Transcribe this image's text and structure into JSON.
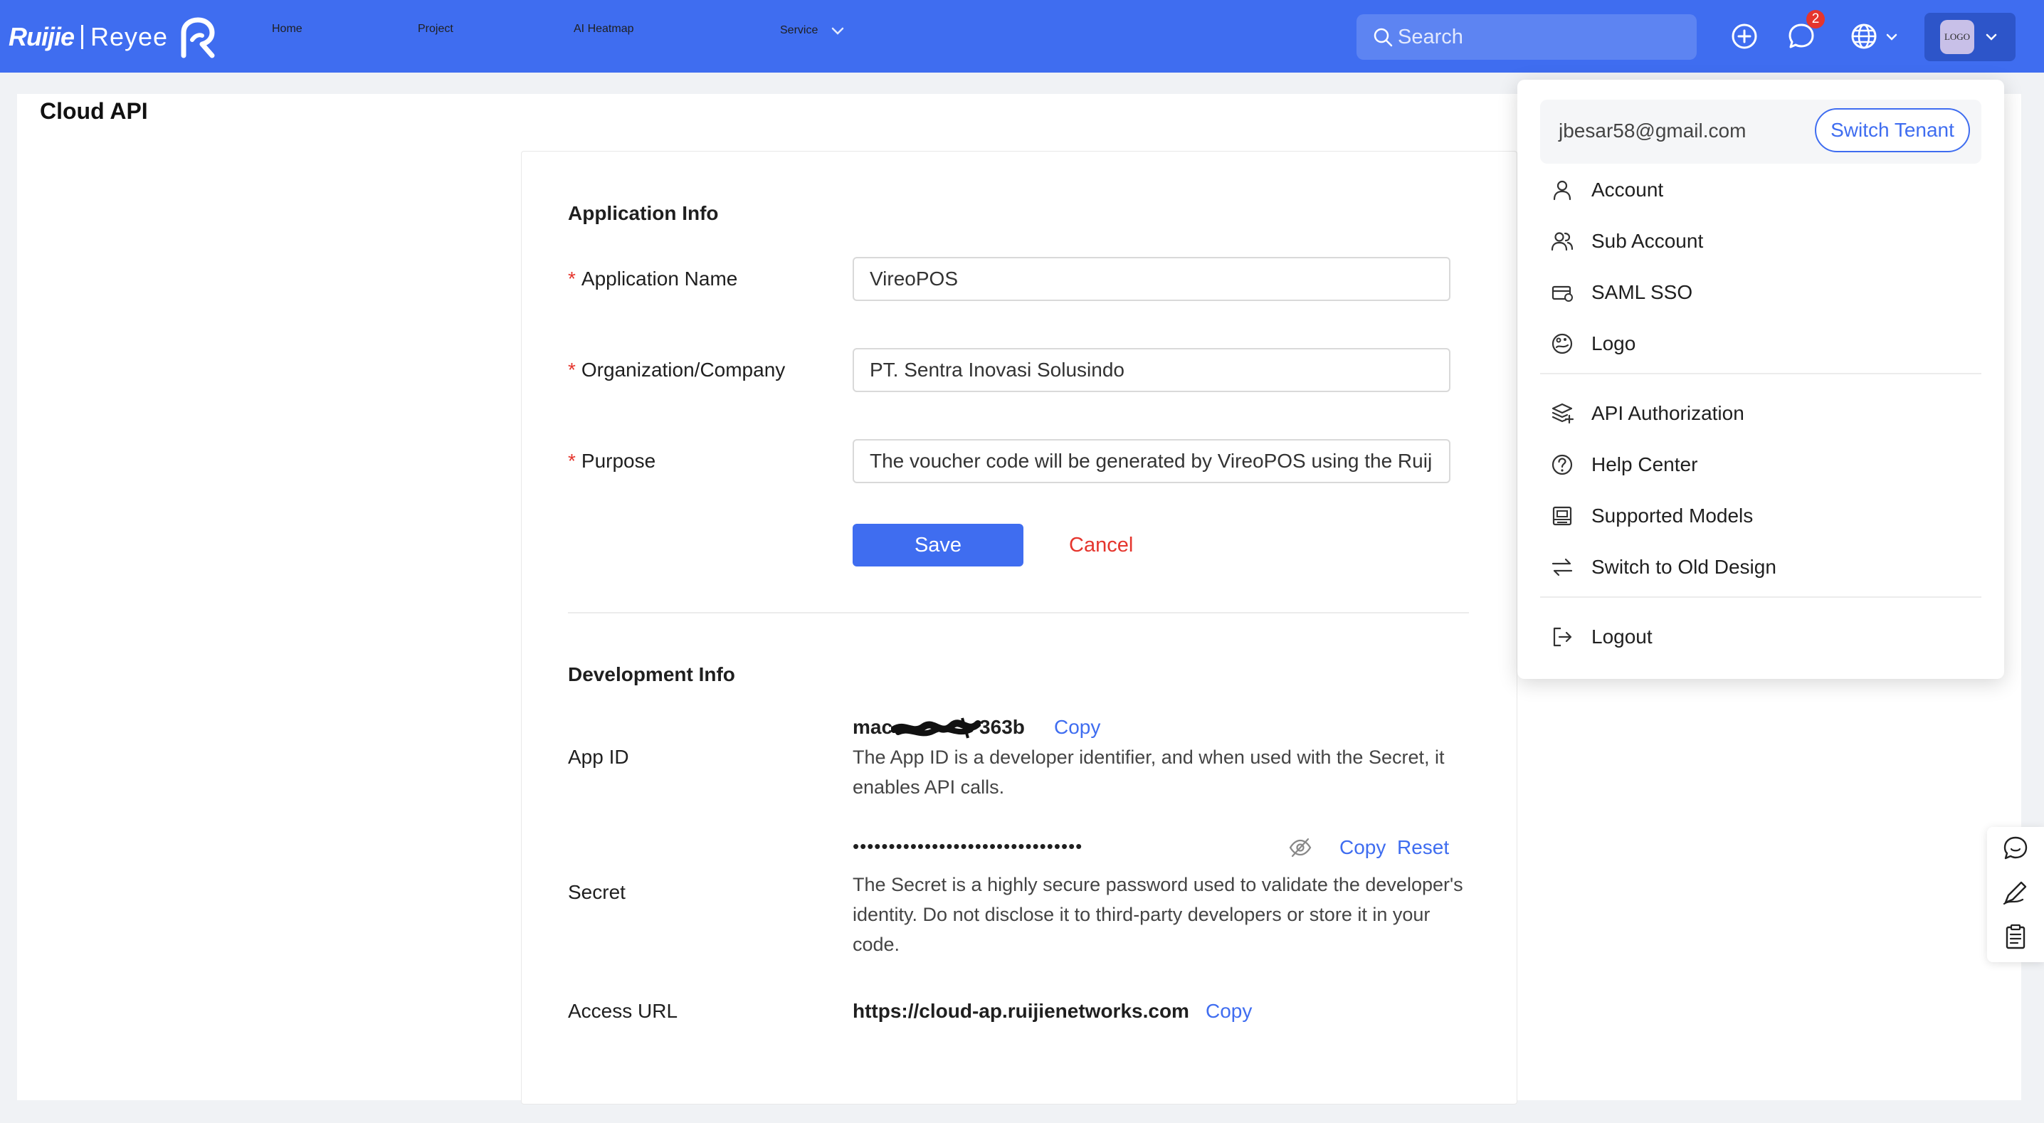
{
  "header": {
    "brand_ruijie": "Ruijie",
    "brand_reyee": "Reyee",
    "nav": [
      "Home",
      "Project",
      "AI Heatmap",
      "Service"
    ],
    "search_placeholder": "Search",
    "notification_count": "2",
    "avatar_text": "LOGO",
    "accent_color": "#3f6df0"
  },
  "page": {
    "title": "Cloud API"
  },
  "application_info": {
    "section_title": "Application Info",
    "app_name_label": "Application Name",
    "app_name_value": "VireoPOS",
    "org_label": "Organization/Company",
    "org_value": "PT. Sentra Inovasi Solusindo",
    "purpose_label": "Purpose",
    "purpose_value": "The voucher code will be generated by VireoPOS using the Ruij",
    "required_mark": "*",
    "save_label": "Save",
    "cancel_label": "Cancel"
  },
  "development_info": {
    "section_title": "Development Info",
    "app_id_label": "App ID",
    "app_id_value_start": "mac",
    "app_id_value_end": "363b",
    "app_id_copy": "Copy",
    "app_id_desc": "The App ID is a developer identifier, and when used with the Secret, it enables API calls.",
    "secret_label": "Secret",
    "secret_masked": "••••••••••••••••••••••••••••••••",
    "secret_copy": "Copy",
    "secret_reset": "Reset",
    "secret_desc": "The Secret is a highly secure password used to validate the developer's identity. Do not disclose it to third-party developers or store it in your code.",
    "access_url_label": "Access URL",
    "access_url_value": "https://cloud-ap.ruijienetworks.com",
    "access_url_copy": "Copy"
  },
  "user_menu": {
    "email": "jbesar58@gmail.com",
    "switch_tenant": "Switch Tenant",
    "items_group1": [
      "Account",
      "Sub Account",
      "SAML SSO",
      "Logo"
    ],
    "items_group2": [
      "API Authorization",
      "Help Center",
      "Supported Models",
      "Switch to Old Design"
    ],
    "logout": "Logout"
  }
}
